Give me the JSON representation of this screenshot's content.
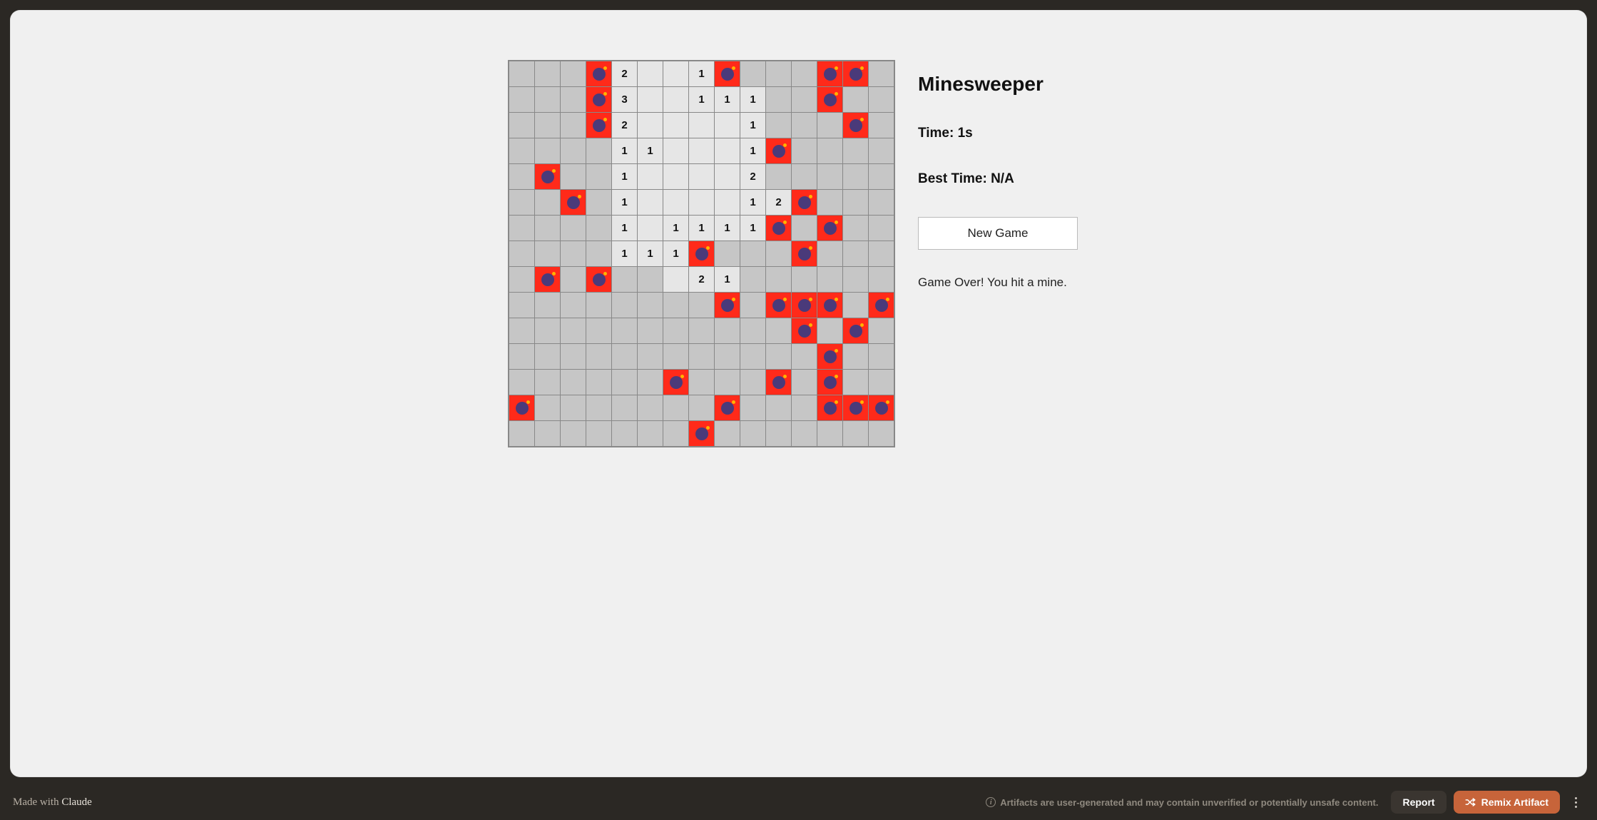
{
  "game": {
    "title": "Minesweeper",
    "time_label": "Time: 1s",
    "best_time_label": "Best Time: N/A",
    "new_game_label": "New Game",
    "status": "Game Over! You hit a mine.",
    "rows": 15,
    "cols": 15,
    "board_legend": "u = unrevealed covered cell, r = revealed empty cell, M = mine, digit = revealed number",
    "board": [
      [
        "u",
        "u",
        "u",
        "M",
        "2",
        "r",
        "r",
        "1",
        "M",
        "u",
        "u",
        "u",
        "M",
        "M",
        "u"
      ],
      [
        "u",
        "u",
        "u",
        "M",
        "3",
        "r",
        "r",
        "1",
        "1",
        "1",
        "u",
        "u",
        "M",
        "u",
        "u"
      ],
      [
        "u",
        "u",
        "u",
        "M",
        "2",
        "r",
        "r",
        "r",
        "r",
        "1",
        "u",
        "u",
        "u",
        "M",
        "u"
      ],
      [
        "u",
        "u",
        "u",
        "u",
        "1",
        "1",
        "r",
        "r",
        "r",
        "1",
        "M",
        "u",
        "u",
        "u",
        "u"
      ],
      [
        "u",
        "M",
        "u",
        "u",
        "1",
        "r",
        "r",
        "r",
        "r",
        "2",
        "u",
        "u",
        "u",
        "u",
        "u"
      ],
      [
        "u",
        "u",
        "M",
        "u",
        "1",
        "r",
        "r",
        "r",
        "r",
        "1",
        "2",
        "M",
        "u",
        "u",
        "u"
      ],
      [
        "u",
        "u",
        "u",
        "u",
        "1",
        "r",
        "1",
        "1",
        "1",
        "1",
        "M",
        "u",
        "M",
        "u",
        "u"
      ],
      [
        "u",
        "u",
        "u",
        "u",
        "1",
        "1",
        "1",
        "M",
        "u",
        "u",
        "u",
        "M",
        "u",
        "u",
        "u"
      ],
      [
        "u",
        "M",
        "u",
        "M",
        "u",
        "u",
        "r",
        "2",
        "1",
        "u",
        "u",
        "u",
        "u",
        "u",
        "u"
      ],
      [
        "u",
        "u",
        "u",
        "u",
        "u",
        "u",
        "u",
        "u",
        "M",
        "u",
        "M",
        "M",
        "M",
        "u",
        "M"
      ],
      [
        "u",
        "u",
        "u",
        "u",
        "u",
        "u",
        "u",
        "u",
        "u",
        "u",
        "u",
        "M",
        "u",
        "M",
        "u"
      ],
      [
        "u",
        "u",
        "u",
        "u",
        "u",
        "u",
        "u",
        "u",
        "u",
        "u",
        "u",
        "u",
        "M",
        "u",
        "u"
      ],
      [
        "u",
        "u",
        "u",
        "u",
        "u",
        "u",
        "M",
        "u",
        "u",
        "u",
        "M",
        "u",
        "M",
        "u",
        "u"
      ],
      [
        "M",
        "u",
        "u",
        "u",
        "u",
        "u",
        "u",
        "u",
        "M",
        "u",
        "u",
        "u",
        "M",
        "M",
        "M"
      ],
      [
        "u",
        "u",
        "u",
        "u",
        "u",
        "u",
        "u",
        "M",
        "u",
        "u",
        "u",
        "u",
        "u",
        "u",
        "u"
      ]
    ]
  },
  "footer": {
    "made_with_prefix": "Made with ",
    "made_with_brand": "Claude",
    "notice": "Artifacts are user-generated and may contain unverified or potentially unsafe content.",
    "report_label": "Report",
    "remix_label": "Remix Artifact"
  }
}
